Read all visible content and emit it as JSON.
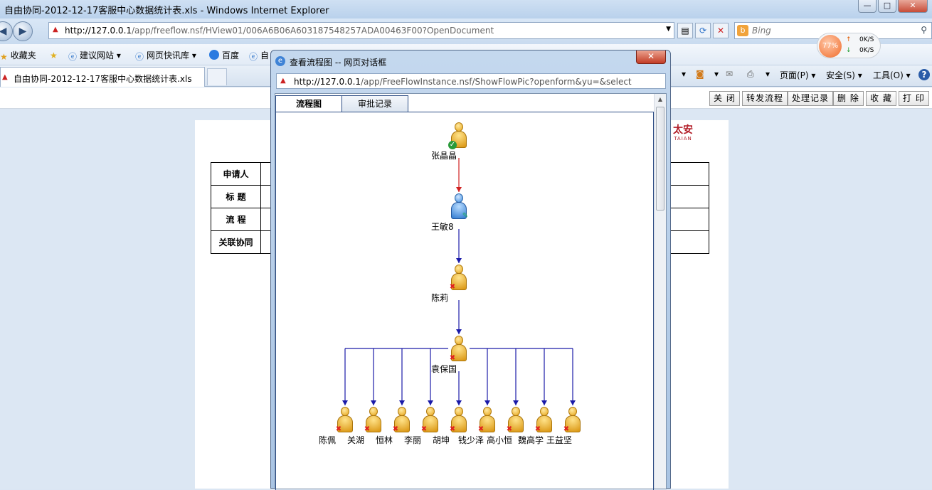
{
  "window": {
    "title": "自由协同-2012-12-17客服中心数据统计表.xls - Windows Internet Explorer",
    "minimize": "—",
    "maximize": "□",
    "close": "✕"
  },
  "nav": {
    "url_host": "http://127.0.0.1",
    "url_path": "/app/freeflow.nsf/HView01/006A6B06A603187548257ADA00463F00?OpenDocument",
    "search_placeholder": "Bing"
  },
  "favorites": {
    "items": [
      "收藏夹",
      "建议网站 ▾",
      "网页快讯库 ▾",
      "百度",
      "自"
    ]
  },
  "speed": {
    "percent": "77%",
    "upload": "0K/S",
    "download": "0K/S"
  },
  "tab": {
    "title": "自由协同-2012-12-17客服中心数据统计表.xls"
  },
  "commands": {
    "page": "页面(P) ▾",
    "safety": "安全(S) ▾",
    "tools": "工具(O) ▾",
    "help": "?"
  },
  "actions": [
    "关 闭",
    "转发流程",
    "处理记录",
    "删 除",
    "收 藏",
    "打 印"
  ],
  "brand": {
    "name": "太安",
    "sub": "TAIAN"
  },
  "form": {
    "rows": [
      "申请人",
      "标 题",
      "流 程",
      "关联协同"
    ]
  },
  "dialog": {
    "title": "查看流程图 -- 网页对话框",
    "close": "✕",
    "url_host": "http://127.0.0.1",
    "url_path": "/app/FreeFlowInstance.nsf/ShowFlowPic?openform&yu=&select",
    "tabs": [
      "流程图",
      "审批记录"
    ]
  },
  "flow": {
    "chain": [
      {
        "name": "张晶晶",
        "status": "approved"
      },
      {
        "name": "王敏8",
        "status": "current"
      },
      {
        "name": "陈莉",
        "status": "rejected"
      },
      {
        "name": "袁保国",
        "status": "rejected"
      }
    ],
    "branches": [
      {
        "name": "陈佩",
        "status": "rejected"
      },
      {
        "name": "关湖",
        "status": "rejected"
      },
      {
        "name": "恒林",
        "status": "rejected"
      },
      {
        "name": "李丽",
        "status": "rejected"
      },
      {
        "name": "胡坤",
        "status": "rejected"
      },
      {
        "name": "钱少泽",
        "status": "rejected"
      },
      {
        "name": "高小恒",
        "status": "rejected"
      },
      {
        "name": "魏高学",
        "status": "rejected"
      },
      {
        "name": "王益坚",
        "status": "rejected"
      }
    ],
    "colors": {
      "first_link": "#d02020",
      "links": "#1a1aa8"
    }
  }
}
